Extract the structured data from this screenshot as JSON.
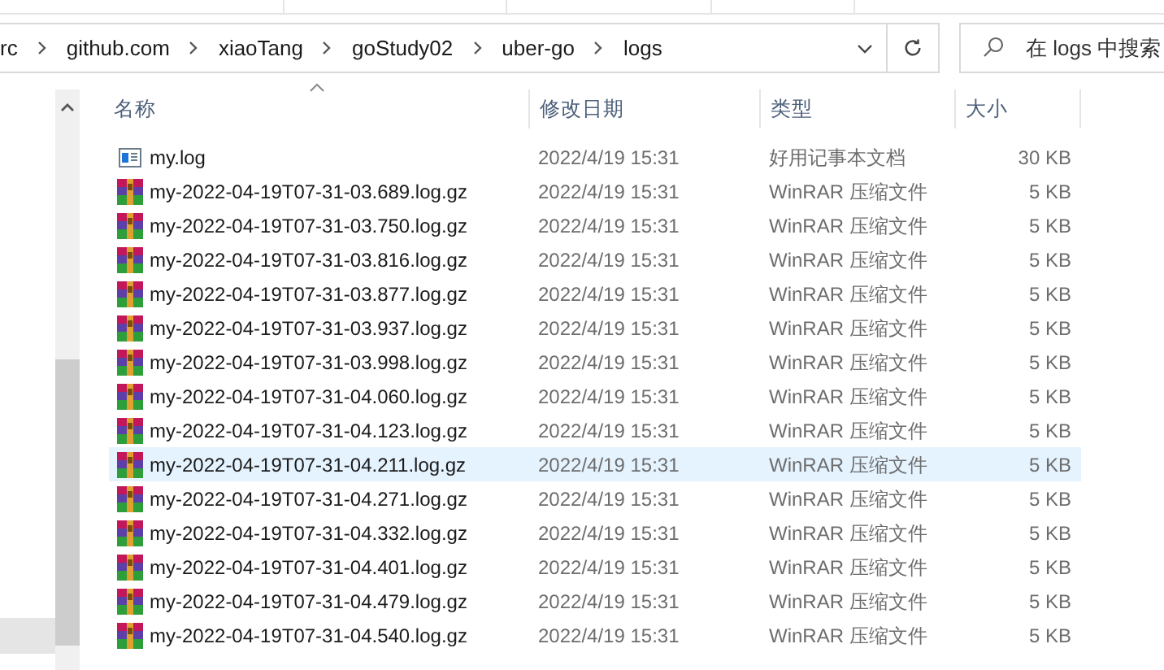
{
  "address_bar": {
    "crumbs": [
      "rc",
      "github.com",
      "xiaoTang",
      "goStudy02",
      "uber-go",
      "logs"
    ]
  },
  "search": {
    "placeholder": "在 logs 中搜索"
  },
  "columns": [
    "名称",
    "修改日期",
    "类型",
    "大小"
  ],
  "files": [
    {
      "kind": "text",
      "name": "my.log",
      "modified": "2022/4/19 15:31",
      "type": "好用记事本文档",
      "size": "30 KB",
      "selected": false
    },
    {
      "kind": "archive",
      "name": "my-2022-04-19T07-31-03.689.log.gz",
      "modified": "2022/4/19 15:31",
      "type": "WinRAR 压缩文件",
      "size": "5 KB",
      "selected": false
    },
    {
      "kind": "archive",
      "name": "my-2022-04-19T07-31-03.750.log.gz",
      "modified": "2022/4/19 15:31",
      "type": "WinRAR 压缩文件",
      "size": "5 KB",
      "selected": false
    },
    {
      "kind": "archive",
      "name": "my-2022-04-19T07-31-03.816.log.gz",
      "modified": "2022/4/19 15:31",
      "type": "WinRAR 压缩文件",
      "size": "5 KB",
      "selected": false
    },
    {
      "kind": "archive",
      "name": "my-2022-04-19T07-31-03.877.log.gz",
      "modified": "2022/4/19 15:31",
      "type": "WinRAR 压缩文件",
      "size": "5 KB",
      "selected": false
    },
    {
      "kind": "archive",
      "name": "my-2022-04-19T07-31-03.937.log.gz",
      "modified": "2022/4/19 15:31",
      "type": "WinRAR 压缩文件",
      "size": "5 KB",
      "selected": false
    },
    {
      "kind": "archive",
      "name": "my-2022-04-19T07-31-03.998.log.gz",
      "modified": "2022/4/19 15:31",
      "type": "WinRAR 压缩文件",
      "size": "5 KB",
      "selected": false
    },
    {
      "kind": "archive",
      "name": "my-2022-04-19T07-31-04.060.log.gz",
      "modified": "2022/4/19 15:31",
      "type": "WinRAR 压缩文件",
      "size": "5 KB",
      "selected": false
    },
    {
      "kind": "archive",
      "name": "my-2022-04-19T07-31-04.123.log.gz",
      "modified": "2022/4/19 15:31",
      "type": "WinRAR 压缩文件",
      "size": "5 KB",
      "selected": false
    },
    {
      "kind": "archive",
      "name": "my-2022-04-19T07-31-04.211.log.gz",
      "modified": "2022/4/19 15:31",
      "type": "WinRAR 压缩文件",
      "size": "5 KB",
      "selected": true
    },
    {
      "kind": "archive",
      "name": "my-2022-04-19T07-31-04.271.log.gz",
      "modified": "2022/4/19 15:31",
      "type": "WinRAR 压缩文件",
      "size": "5 KB",
      "selected": false
    },
    {
      "kind": "archive",
      "name": "my-2022-04-19T07-31-04.332.log.gz",
      "modified": "2022/4/19 15:31",
      "type": "WinRAR 压缩文件",
      "size": "5 KB",
      "selected": false
    },
    {
      "kind": "archive",
      "name": "my-2022-04-19T07-31-04.401.log.gz",
      "modified": "2022/4/19 15:31",
      "type": "WinRAR 压缩文件",
      "size": "5 KB",
      "selected": false
    },
    {
      "kind": "archive",
      "name": "my-2022-04-19T07-31-04.479.log.gz",
      "modified": "2022/4/19 15:31",
      "type": "WinRAR 压缩文件",
      "size": "5 KB",
      "selected": false
    },
    {
      "kind": "archive",
      "name": "my-2022-04-19T07-31-04.540.log.gz",
      "modified": "2022/4/19 15:31",
      "type": "WinRAR 压缩文件",
      "size": "5 KB",
      "selected": false
    }
  ]
}
